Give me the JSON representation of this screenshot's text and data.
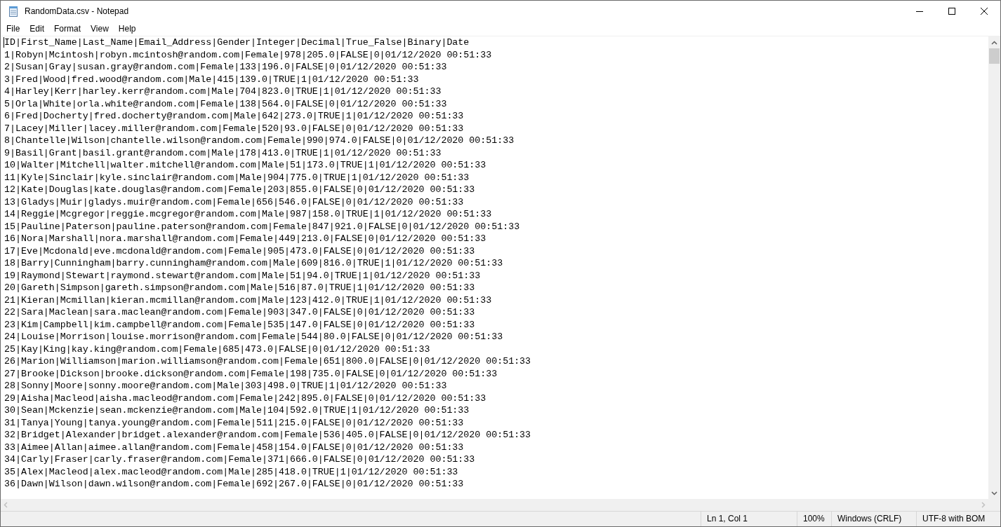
{
  "window": {
    "title": "RandomData.csv - Notepad"
  },
  "menu": [
    "File",
    "Edit",
    "Format",
    "View",
    "Help"
  ],
  "lines": [
    "ID|First_Name|Last_Name|Email_Address|Gender|Integer|Decimal|True_False|Binary|Date",
    "1|Robyn|Mcintosh|robyn.mcintosh@random.com|Female|978|205.0|FALSE|0|01/12/2020 00:51:33",
    "2|Susan|Gray|susan.gray@random.com|Female|133|196.0|FALSE|0|01/12/2020 00:51:33",
    "3|Fred|Wood|fred.wood@random.com|Male|415|139.0|TRUE|1|01/12/2020 00:51:33",
    "4|Harley|Kerr|harley.kerr@random.com|Male|704|823.0|TRUE|1|01/12/2020 00:51:33",
    "5|Orla|White|orla.white@random.com|Female|138|564.0|FALSE|0|01/12/2020 00:51:33",
    "6|Fred|Docherty|fred.docherty@random.com|Male|642|273.0|TRUE|1|01/12/2020 00:51:33",
    "7|Lacey|Miller|lacey.miller@random.com|Female|520|93.0|FALSE|0|01/12/2020 00:51:33",
    "8|Chantelle|Wilson|chantelle.wilson@random.com|Female|990|974.0|FALSE|0|01/12/2020 00:51:33",
    "9|Basil|Grant|basil.grant@random.com|Male|178|413.0|TRUE|1|01/12/2020 00:51:33",
    "10|Walter|Mitchell|walter.mitchell@random.com|Male|51|173.0|TRUE|1|01/12/2020 00:51:33",
    "11|Kyle|Sinclair|kyle.sinclair@random.com|Male|904|775.0|TRUE|1|01/12/2020 00:51:33",
    "12|Kate|Douglas|kate.douglas@random.com|Female|203|855.0|FALSE|0|01/12/2020 00:51:33",
    "13|Gladys|Muir|gladys.muir@random.com|Female|656|546.0|FALSE|0|01/12/2020 00:51:33",
    "14|Reggie|Mcgregor|reggie.mcgregor@random.com|Male|987|158.0|TRUE|1|01/12/2020 00:51:33",
    "15|Pauline|Paterson|pauline.paterson@random.com|Female|847|921.0|FALSE|0|01/12/2020 00:51:33",
    "16|Nora|Marshall|nora.marshall@random.com|Female|449|213.0|FALSE|0|01/12/2020 00:51:33",
    "17|Eve|Mcdonald|eve.mcdonald@random.com|Female|905|473.0|FALSE|0|01/12/2020 00:51:33",
    "18|Barry|Cunningham|barry.cunningham@random.com|Male|609|816.0|TRUE|1|01/12/2020 00:51:33",
    "19|Raymond|Stewart|raymond.stewart@random.com|Male|51|94.0|TRUE|1|01/12/2020 00:51:33",
    "20|Gareth|Simpson|gareth.simpson@random.com|Male|516|87.0|TRUE|1|01/12/2020 00:51:33",
    "21|Kieran|Mcmillan|kieran.mcmillan@random.com|Male|123|412.0|TRUE|1|01/12/2020 00:51:33",
    "22|Sara|Maclean|sara.maclean@random.com|Female|903|347.0|FALSE|0|01/12/2020 00:51:33",
    "23|Kim|Campbell|kim.campbell@random.com|Female|535|147.0|FALSE|0|01/12/2020 00:51:33",
    "24|Louise|Morrison|louise.morrison@random.com|Female|544|80.0|FALSE|0|01/12/2020 00:51:33",
    "25|Kay|King|kay.king@random.com|Female|685|473.0|FALSE|0|01/12/2020 00:51:33",
    "26|Marion|Williamson|marion.williamson@random.com|Female|651|800.0|FALSE|0|01/12/2020 00:51:33",
    "27|Brooke|Dickson|brooke.dickson@random.com|Female|198|735.0|FALSE|0|01/12/2020 00:51:33",
    "28|Sonny|Moore|sonny.moore@random.com|Male|303|498.0|TRUE|1|01/12/2020 00:51:33",
    "29|Aisha|Macleod|aisha.macleod@random.com|Female|242|895.0|FALSE|0|01/12/2020 00:51:33",
    "30|Sean|Mckenzie|sean.mckenzie@random.com|Male|104|592.0|TRUE|1|01/12/2020 00:51:33",
    "31|Tanya|Young|tanya.young@random.com|Female|511|215.0|FALSE|0|01/12/2020 00:51:33",
    "32|Bridget|Alexander|bridget.alexander@random.com|Female|536|405.0|FALSE|0|01/12/2020 00:51:33",
    "33|Aimee|Allan|aimee.allan@random.com|Female|458|154.0|FALSE|0|01/12/2020 00:51:33",
    "34|Carly|Fraser|carly.fraser@random.com|Female|371|666.0|FALSE|0|01/12/2020 00:51:33",
    "35|Alex|Macleod|alex.macleod@random.com|Male|285|418.0|TRUE|1|01/12/2020 00:51:33",
    "36|Dawn|Wilson|dawn.wilson@random.com|Female|692|267.0|FALSE|0|01/12/2020 00:51:33"
  ],
  "status_bar": {
    "position": "Ln 1, Col 1",
    "zoom": "100%",
    "line_ending": "Windows (CRLF)",
    "encoding": "UTF-8 with BOM"
  }
}
